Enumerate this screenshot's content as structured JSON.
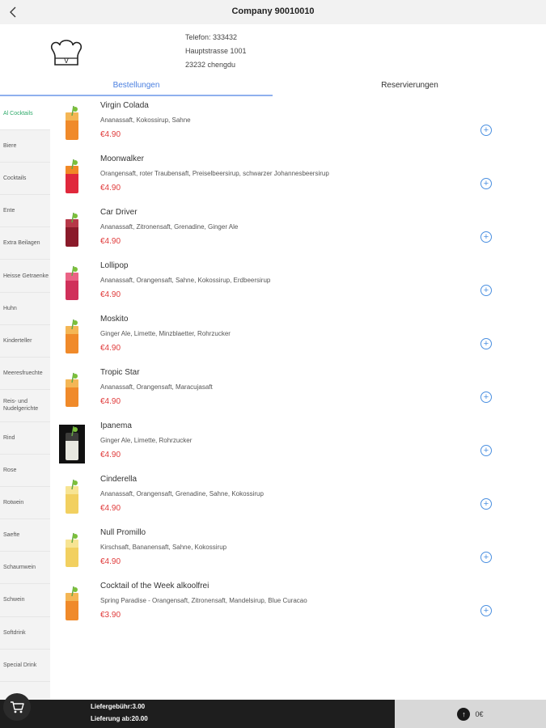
{
  "app": {
    "title": "Company 90010010"
  },
  "header": {
    "phone": "Telefon: 333432",
    "street": "Hauptstrasse 1001",
    "city": "23232 chengdu",
    "logo_letter": "V"
  },
  "tabs": [
    {
      "label": "Bestellungen",
      "active": true
    },
    {
      "label": "Reservierungen",
      "active": false
    }
  ],
  "categories": [
    "Al Cocktails",
    "Biere",
    "Cocktails",
    "Ente",
    "Extra Beilagen",
    "Heisse Getraenke",
    "Huhn",
    "Kinderteller",
    "Meeresfruechte",
    "Reis- und Nudelgerichte",
    "Rind",
    "Rose",
    "Rotwein",
    "Saefte",
    "Schaumwein",
    "Schwein",
    "Softdrink",
    "Special Drink"
  ],
  "items": [
    {
      "name": "Virgin Colada",
      "desc": "Ananassaft, Kokossirup, Sahne",
      "price": "€4.90",
      "icon": "orange-cocktail-glass"
    },
    {
      "name": "Moonwalker",
      "desc": "Orangensaft, roter Traubensaft, Preiselbeersirup, schwarzer Johannesbeersirup",
      "price": "€4.90",
      "icon": "red-cocktail-glass"
    },
    {
      "name": "Car Driver",
      "desc": "Ananassaft, Zitronensaft, Grenadine, Ginger Ale",
      "price": "€4.90",
      "icon": "dark-red-cocktail-glass"
    },
    {
      "name": "Lollipop",
      "desc": "Ananassaft, Orangensaft, Sahne, Kokossirup, Erdbeersirup",
      "price": "€4.90",
      "icon": "pink-cocktail-glass"
    },
    {
      "name": "Moskito",
      "desc": "Ginger Ale, Limette, Minzblaetter, Rohrzucker",
      "price": "€4.90",
      "icon": "orange-cocktail-glass"
    },
    {
      "name": "Tropic Star",
      "desc": "Ananassaft, Orangensaft, Maracujasaft",
      "price": "€4.90",
      "icon": "orange-cocktail-glass"
    },
    {
      "name": "Ipanema",
      "desc": "Ginger Ale, Limette, Rohrzucker",
      "price": "€4.90",
      "icon": "white-cocktail-glass"
    },
    {
      "name": "Cinderella",
      "desc": "Ananassaft, Orangensaft, Grenadine, Sahne, Kokossirup",
      "price": "€4.90",
      "icon": "yellow-cocktail-glass"
    },
    {
      "name": "Null Promillo",
      "desc": "Kirschsaft, Bananensaft, Sahne, Kokossirup",
      "price": "€4.90",
      "icon": "yellow-cocktail-glass"
    },
    {
      "name": "Cocktail of the Week alkoolfrei",
      "desc": "Spring Paradise - Orangensaft, Zitronensaft, Mandelsirup, Blue Curacao",
      "price": "€3.90",
      "icon": "orange-cocktail-glass"
    }
  ],
  "footer": {
    "delivery_fee": "Liefergebühr:3.00",
    "delivery_min": "Lieferung ab:20.00",
    "total": "0€"
  },
  "colors": {
    "accent": "#4a7fe0",
    "price": "#e03b3b",
    "active_category": "#2eaa6a"
  }
}
